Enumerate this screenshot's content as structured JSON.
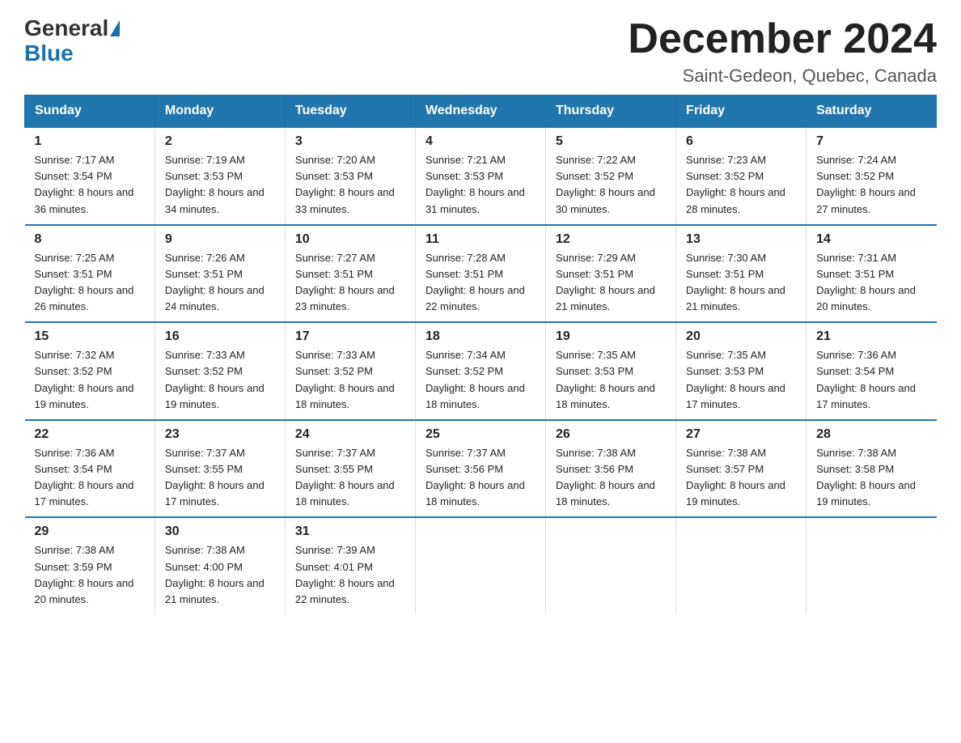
{
  "logo": {
    "general": "General",
    "triangle": "▶",
    "blue": "Blue"
  },
  "header": {
    "title": "December 2024",
    "subtitle": "Saint-Gedeon, Quebec, Canada"
  },
  "weekdays": [
    "Sunday",
    "Monday",
    "Tuesday",
    "Wednesday",
    "Thursday",
    "Friday",
    "Saturday"
  ],
  "weeks": [
    [
      {
        "day": "1",
        "sunrise": "7:17 AM",
        "sunset": "3:54 PM",
        "daylight": "8 hours and 36 minutes."
      },
      {
        "day": "2",
        "sunrise": "7:19 AM",
        "sunset": "3:53 PM",
        "daylight": "8 hours and 34 minutes."
      },
      {
        "day": "3",
        "sunrise": "7:20 AM",
        "sunset": "3:53 PM",
        "daylight": "8 hours and 33 minutes."
      },
      {
        "day": "4",
        "sunrise": "7:21 AM",
        "sunset": "3:53 PM",
        "daylight": "8 hours and 31 minutes."
      },
      {
        "day": "5",
        "sunrise": "7:22 AM",
        "sunset": "3:52 PM",
        "daylight": "8 hours and 30 minutes."
      },
      {
        "day": "6",
        "sunrise": "7:23 AM",
        "sunset": "3:52 PM",
        "daylight": "8 hours and 28 minutes."
      },
      {
        "day": "7",
        "sunrise": "7:24 AM",
        "sunset": "3:52 PM",
        "daylight": "8 hours and 27 minutes."
      }
    ],
    [
      {
        "day": "8",
        "sunrise": "7:25 AM",
        "sunset": "3:51 PM",
        "daylight": "8 hours and 26 minutes."
      },
      {
        "day": "9",
        "sunrise": "7:26 AM",
        "sunset": "3:51 PM",
        "daylight": "8 hours and 24 minutes."
      },
      {
        "day": "10",
        "sunrise": "7:27 AM",
        "sunset": "3:51 PM",
        "daylight": "8 hours and 23 minutes."
      },
      {
        "day": "11",
        "sunrise": "7:28 AM",
        "sunset": "3:51 PM",
        "daylight": "8 hours and 22 minutes."
      },
      {
        "day": "12",
        "sunrise": "7:29 AM",
        "sunset": "3:51 PM",
        "daylight": "8 hours and 21 minutes."
      },
      {
        "day": "13",
        "sunrise": "7:30 AM",
        "sunset": "3:51 PM",
        "daylight": "8 hours and 21 minutes."
      },
      {
        "day": "14",
        "sunrise": "7:31 AM",
        "sunset": "3:51 PM",
        "daylight": "8 hours and 20 minutes."
      }
    ],
    [
      {
        "day": "15",
        "sunrise": "7:32 AM",
        "sunset": "3:52 PM",
        "daylight": "8 hours and 19 minutes."
      },
      {
        "day": "16",
        "sunrise": "7:33 AM",
        "sunset": "3:52 PM",
        "daylight": "8 hours and 19 minutes."
      },
      {
        "day": "17",
        "sunrise": "7:33 AM",
        "sunset": "3:52 PM",
        "daylight": "8 hours and 18 minutes."
      },
      {
        "day": "18",
        "sunrise": "7:34 AM",
        "sunset": "3:52 PM",
        "daylight": "8 hours and 18 minutes."
      },
      {
        "day": "19",
        "sunrise": "7:35 AM",
        "sunset": "3:53 PM",
        "daylight": "8 hours and 18 minutes."
      },
      {
        "day": "20",
        "sunrise": "7:35 AM",
        "sunset": "3:53 PM",
        "daylight": "8 hours and 17 minutes."
      },
      {
        "day": "21",
        "sunrise": "7:36 AM",
        "sunset": "3:54 PM",
        "daylight": "8 hours and 17 minutes."
      }
    ],
    [
      {
        "day": "22",
        "sunrise": "7:36 AM",
        "sunset": "3:54 PM",
        "daylight": "8 hours and 17 minutes."
      },
      {
        "day": "23",
        "sunrise": "7:37 AM",
        "sunset": "3:55 PM",
        "daylight": "8 hours and 17 minutes."
      },
      {
        "day": "24",
        "sunrise": "7:37 AM",
        "sunset": "3:55 PM",
        "daylight": "8 hours and 18 minutes."
      },
      {
        "day": "25",
        "sunrise": "7:37 AM",
        "sunset": "3:56 PM",
        "daylight": "8 hours and 18 minutes."
      },
      {
        "day": "26",
        "sunrise": "7:38 AM",
        "sunset": "3:56 PM",
        "daylight": "8 hours and 18 minutes."
      },
      {
        "day": "27",
        "sunrise": "7:38 AM",
        "sunset": "3:57 PM",
        "daylight": "8 hours and 19 minutes."
      },
      {
        "day": "28",
        "sunrise": "7:38 AM",
        "sunset": "3:58 PM",
        "daylight": "8 hours and 19 minutes."
      }
    ],
    [
      {
        "day": "29",
        "sunrise": "7:38 AM",
        "sunset": "3:59 PM",
        "daylight": "8 hours and 20 minutes."
      },
      {
        "day": "30",
        "sunrise": "7:38 AM",
        "sunset": "4:00 PM",
        "daylight": "8 hours and 21 minutes."
      },
      {
        "day": "31",
        "sunrise": "7:39 AM",
        "sunset": "4:01 PM",
        "daylight": "8 hours and 22 minutes."
      },
      null,
      null,
      null,
      null
    ]
  ]
}
